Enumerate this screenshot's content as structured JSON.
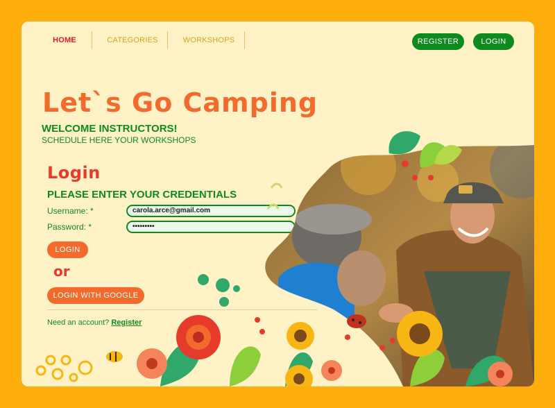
{
  "nav": {
    "tabs": [
      {
        "label": "HOME",
        "active": true
      },
      {
        "label": "CATEGORIES",
        "active": false
      },
      {
        "label": "WORKSHOPS",
        "active": false
      }
    ],
    "register_label": "REGISTER",
    "login_label": "LOGIN"
  },
  "hero": {
    "title": "Let`s Go Camping",
    "welcome": "WELCOME INSTRUCTORS!",
    "subtitle": "SCHEDULE HERE YOUR WORKSHOPS"
  },
  "login": {
    "heading": "Login",
    "credentials_prompt": "PLEASE ENTER YOUR CREDENTIALS",
    "username_label": "Username: *",
    "username_value": "carola.arce@gmail.com",
    "password_label": "Password: *",
    "password_value": "•••••••••",
    "login_button": "LOGIN",
    "or_text": "or",
    "google_button": "LOGIN WITH GOOGLE",
    "need_account": "Need an account?",
    "register_link": "Register"
  },
  "colors": {
    "background": "#fdae0c",
    "card": "#fff2c7",
    "green": "#0e8a1f",
    "orange": "#f26b2d",
    "red": "#e31b23"
  }
}
